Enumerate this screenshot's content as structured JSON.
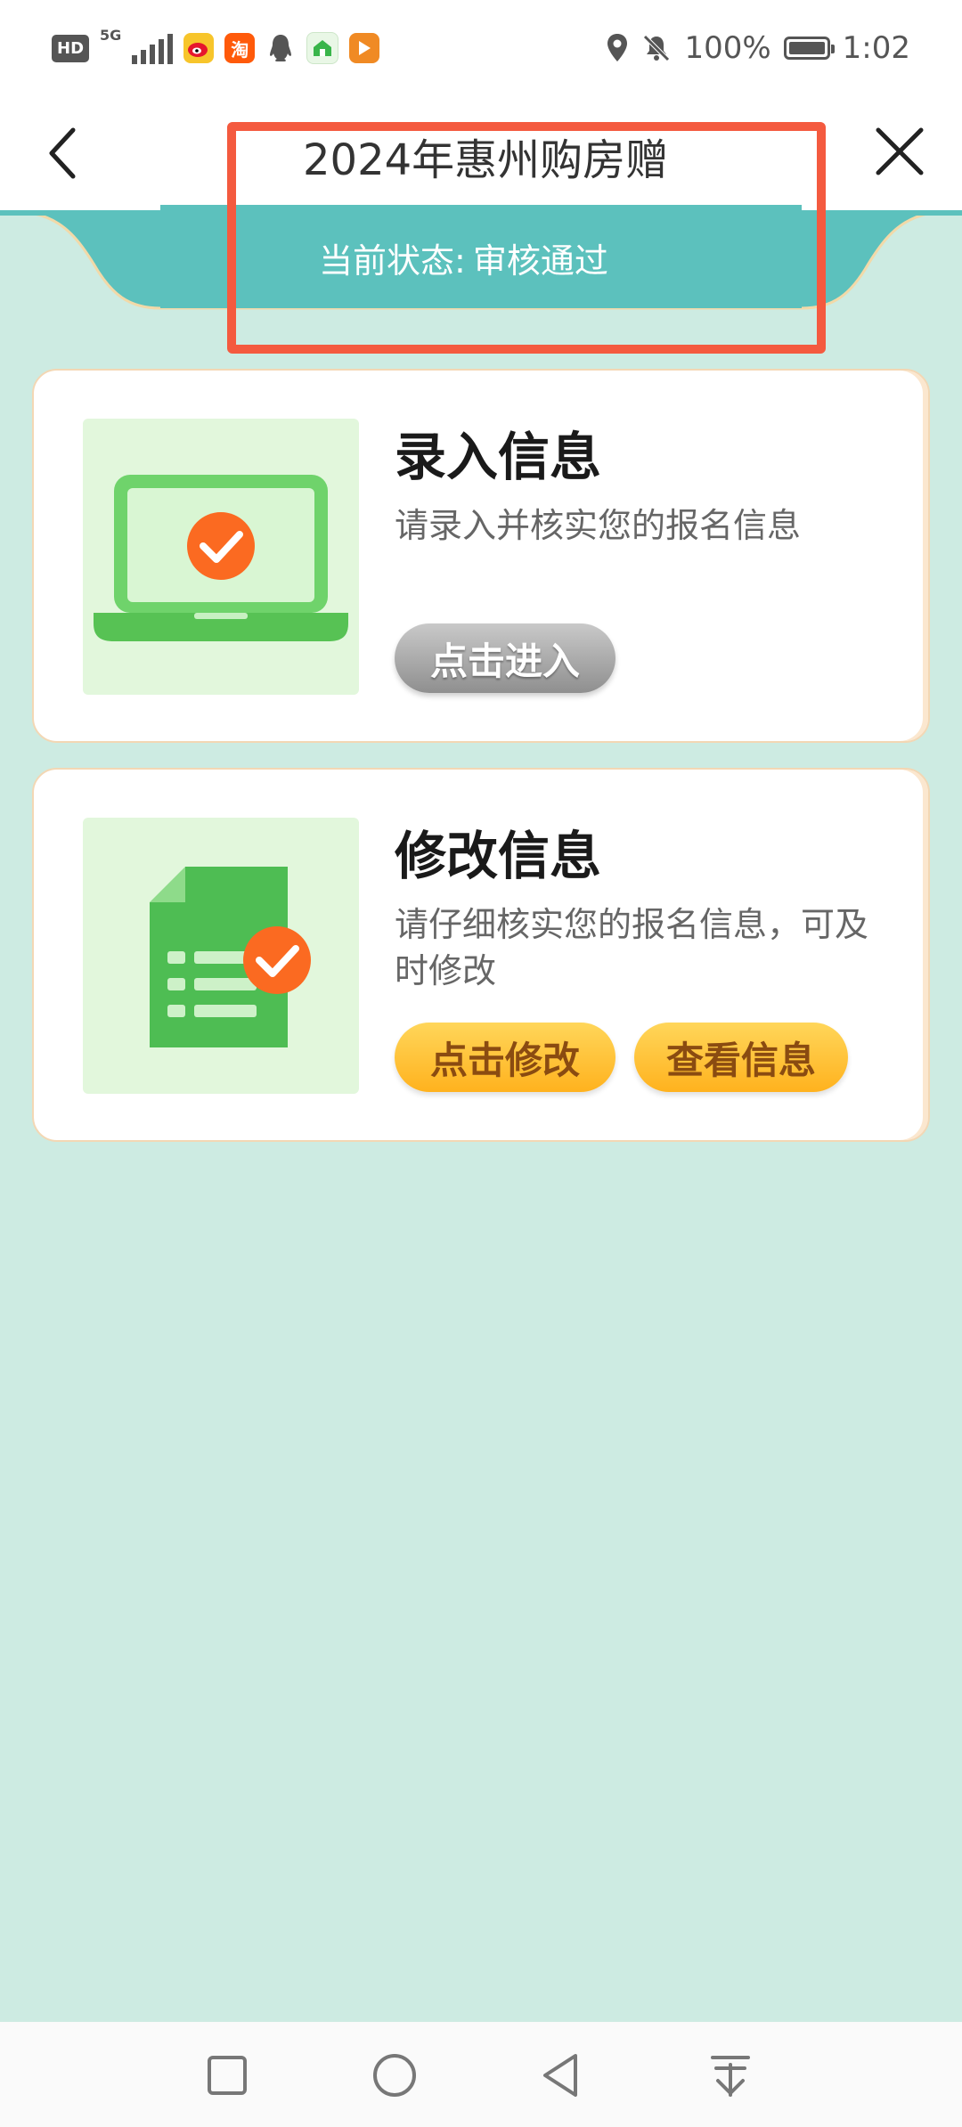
{
  "status_bar": {
    "hd": "HD",
    "network": "5G",
    "battery": "100%",
    "time": "1:02",
    "app_icons": [
      "weibo-icon",
      "taobao-icon",
      "qq-icon",
      "housing-app-icon",
      "video-app-icon"
    ],
    "taobao_label": "淘"
  },
  "header": {
    "title": "2024年惠州购房赠",
    "status_label": "当前状态:",
    "status_value": "审核通过"
  },
  "cards": [
    {
      "title": "录入信息",
      "desc": "请录入并核实您的报名信息",
      "button": "点击进入",
      "icon": "laptop-check-icon"
    },
    {
      "title": "修改信息",
      "desc": "请仔细核实您的报名信息，可及时修改",
      "buttons": [
        "点击修改",
        "查看信息"
      ],
      "icon": "document-check-icon"
    }
  ],
  "colors": {
    "background": "#cdebe2",
    "teal": "#5cc1bd",
    "highlight_red": "#f45a3f",
    "gray_button": "#a9a9a9",
    "yellow_button": "#ffc13a"
  }
}
